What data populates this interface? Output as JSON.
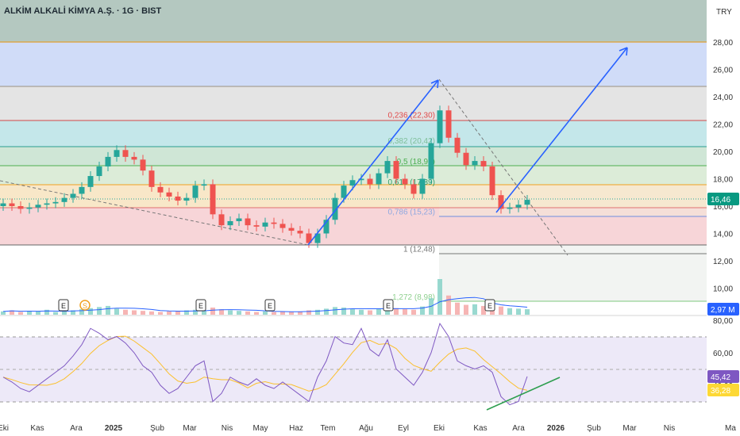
{
  "header": {
    "title": "ALKİM ALKALİ KİMYA A.Ş. · 1G · BIST",
    "currency": "TRY"
  },
  "chart_data": [
    {
      "type": "candlestick",
      "title": "ALKİM ALKALİ KİMYA A.Ş. · 1G · BIST",
      "ylabel": "TRY",
      "ylim": [
        9,
        29
      ],
      "y_ticks": [
        "28,00",
        "26,00",
        "24,00",
        "22,00",
        "20,00",
        "18,00",
        "16,00",
        "14,00",
        "12,00",
        "10,00"
      ],
      "y_tick_values": [
        28,
        26,
        24,
        22,
        20,
        18,
        16,
        14,
        12,
        10
      ],
      "x_ticks": [
        "Eki",
        "Kas",
        "Ara",
        "2025",
        "Şub",
        "Mar",
        "Nis",
        "May",
        "Haz",
        "Tem",
        "Ağu",
        "Eyl",
        "Eki",
        "Kas",
        "Ara",
        "2026",
        "Şub",
        "Mar",
        "Nis",
        "Ma"
      ],
      "closes": [
        16.2,
        16.0,
        15.8,
        15.9,
        16.1,
        16.2,
        16.3,
        16.6,
        16.9,
        17.4,
        18.2,
        18.9,
        19.6,
        20.1,
        19.6,
        19.4,
        18.6,
        17.4,
        17.0,
        16.7,
        16.4,
        16.6,
        17.5,
        17.6,
        15.4,
        14.6,
        14.9,
        15.1,
        14.6,
        14.5,
        14.8,
        14.7,
        14.4,
        14.2,
        14.0,
        13.3,
        14.0,
        15.0,
        16.6,
        17.5,
        17.9,
        18.0,
        17.6,
        18.4,
        19.3,
        18.0,
        17.6,
        16.9,
        18.0,
        20.6,
        23.0,
        21.0,
        19.9,
        19.0,
        19.3,
        18.9,
        16.8,
        15.8,
        15.9,
        16.1,
        16.46
      ],
      "last_price": "16,46",
      "fib_levels": [
        {
          "label": "0,236 (22,30)",
          "value": 22.3,
          "color": "#e04a4a"
        },
        {
          "label": "0,382 (20,42)",
          "value": 20.42,
          "color": "#7fbf9a"
        },
        {
          "label": "0,5 (18,91)",
          "value": 18.91,
          "color": "#4caf50"
        },
        {
          "label": "0,618 (17,39)",
          "value": 17.39,
          "color": "#2e9e6a"
        },
        {
          "label": "0,786 (15,23)",
          "value": 15.23,
          "color": "#8fa8e0"
        },
        {
          "label": "1 (12,48)",
          "value": 12.48,
          "color": "#777777"
        },
        {
          "label": "1,272 (8,98)",
          "value": 8.98,
          "color": "#8fd08f"
        }
      ],
      "events": [
        "E",
        "S",
        "E",
        "E",
        "E",
        "E"
      ]
    },
    {
      "type": "bar",
      "title": "Volume",
      "last_value": "2,97 M",
      "values": [
        0.6,
        0.8,
        0.5,
        0.7,
        0.6,
        0.9,
        0.5,
        0.6,
        0.8,
        1.0,
        1.2,
        1.4,
        1.6,
        1.1,
        0.9,
        0.8,
        0.7,
        0.6,
        0.5,
        0.6,
        0.7,
        0.8,
        0.9,
        0.7,
        1.3,
        1.0,
        0.8,
        0.7,
        0.6,
        0.5,
        0.6,
        0.5,
        0.6,
        0.5,
        0.6,
        0.8,
        0.9,
        1.1,
        1.4,
        1.3,
        1.0,
        0.9,
        0.8,
        1.1,
        1.6,
        1.2,
        1.0,
        0.9,
        1.5,
        3.0,
        6.5,
        3.5,
        2.2,
        1.8,
        1.9,
        1.6,
        1.8,
        1.5,
        1.2,
        1.1,
        1.0
      ]
    },
    {
      "type": "line",
      "title": "RSI",
      "ylim": [
        20,
        90
      ],
      "y_ticks": [
        "80,00",
        "60,00",
        "40,00"
      ],
      "y_tick_values": [
        80,
        60,
        40
      ],
      "rsi_value": "45,42",
      "rsi_ma_value": "36,28",
      "values": [
        45,
        42,
        38,
        36,
        40,
        44,
        48,
        52,
        58,
        65,
        75,
        72,
        68,
        70,
        66,
        60,
        52,
        48,
        40,
        35,
        38,
        45,
        52,
        55,
        30,
        35,
        45,
        42,
        40,
        44,
        40,
        38,
        42,
        38,
        34,
        30,
        45,
        55,
        70,
        66,
        65,
        75,
        62,
        58,
        68,
        50,
        45,
        40,
        48,
        60,
        78,
        70,
        55,
        52,
        50,
        52,
        48,
        33,
        28,
        30,
        45.42
      ]
    }
  ],
  "colors": {
    "up": "#26a69a",
    "down": "#ef5350",
    "rsi": "#7e57c2",
    "rsi_ma": "#fbc02d",
    "arrow": "#2962ff",
    "trend": "#2e9e4f"
  }
}
